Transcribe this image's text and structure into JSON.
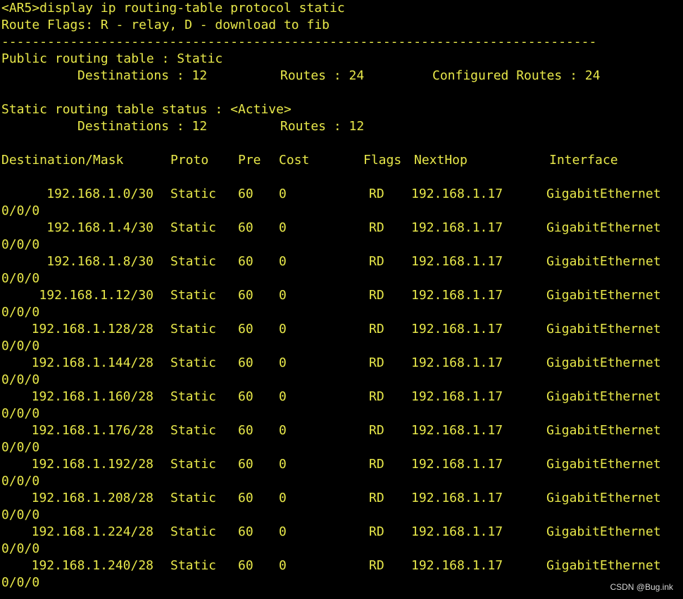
{
  "terminal": {
    "command_line": "<AR5>display ip routing-table protocol static",
    "route_flags": "Route Flags: R - relay, D - download to fib",
    "separator": "------------------------------------------------------------------------------",
    "public_table_title": "Public routing table : Static",
    "public_stats": {
      "destinations": "Destinations : 12",
      "routes": "Routes : 24",
      "configured": "Configured Routes : 24"
    },
    "status_title": "Static routing table status : <Active>",
    "status_stats": {
      "destinations": "Destinations : 12",
      "routes": "Routes : 12"
    },
    "headers": {
      "destination": "Destination/Mask",
      "proto": "Proto",
      "pre": "Pre",
      "cost": "Cost",
      "flags": "Flags",
      "nexthop": "NextHop",
      "interface": "Interface"
    },
    "routes": [
      {
        "dest": "192.168.1.0/30",
        "proto": "Static",
        "pre": "60",
        "cost": "0",
        "flags": "RD",
        "nexthop": "192.168.1.17",
        "iface": "GigabitEthernet",
        "iface_cont": "0/0/0"
      },
      {
        "dest": "192.168.1.4/30",
        "proto": "Static",
        "pre": "60",
        "cost": "0",
        "flags": "RD",
        "nexthop": "192.168.1.17",
        "iface": "GigabitEthernet",
        "iface_cont": "0/0/0"
      },
      {
        "dest": "192.168.1.8/30",
        "proto": "Static",
        "pre": "60",
        "cost": "0",
        "flags": "RD",
        "nexthop": "192.168.1.17",
        "iface": "GigabitEthernet",
        "iface_cont": "0/0/0"
      },
      {
        "dest": "192.168.1.12/30",
        "proto": "Static",
        "pre": "60",
        "cost": "0",
        "flags": "RD",
        "nexthop": "192.168.1.17",
        "iface": "GigabitEthernet",
        "iface_cont": "0/0/0"
      },
      {
        "dest": "192.168.1.128/28",
        "proto": "Static",
        "pre": "60",
        "cost": "0",
        "flags": "RD",
        "nexthop": "192.168.1.17",
        "iface": "GigabitEthernet",
        "iface_cont": "0/0/0"
      },
      {
        "dest": "192.168.1.144/28",
        "proto": "Static",
        "pre": "60",
        "cost": "0",
        "flags": "RD",
        "nexthop": "192.168.1.17",
        "iface": "GigabitEthernet",
        "iface_cont": "0/0/0"
      },
      {
        "dest": "192.168.1.160/28",
        "proto": "Static",
        "pre": "60",
        "cost": "0",
        "flags": "RD",
        "nexthop": "192.168.1.17",
        "iface": "GigabitEthernet",
        "iface_cont": "0/0/0"
      },
      {
        "dest": "192.168.1.176/28",
        "proto": "Static",
        "pre": "60",
        "cost": "0",
        "flags": "RD",
        "nexthop": "192.168.1.17",
        "iface": "GigabitEthernet",
        "iface_cont": "0/0/0"
      },
      {
        "dest": "192.168.1.192/28",
        "proto": "Static",
        "pre": "60",
        "cost": "0",
        "flags": "RD",
        "nexthop": "192.168.1.17",
        "iface": "GigabitEthernet",
        "iface_cont": "0/0/0"
      },
      {
        "dest": "192.168.1.208/28",
        "proto": "Static",
        "pre": "60",
        "cost": "0",
        "flags": "RD",
        "nexthop": "192.168.1.17",
        "iface": "GigabitEthernet",
        "iface_cont": "0/0/0"
      },
      {
        "dest": "192.168.1.224/28",
        "proto": "Static",
        "pre": "60",
        "cost": "0",
        "flags": "RD",
        "nexthop": "192.168.1.17",
        "iface": "GigabitEthernet",
        "iface_cont": "0/0/0"
      },
      {
        "dest": "192.168.1.240/28",
        "proto": "Static",
        "pre": "60",
        "cost": "0",
        "flags": "RD",
        "nexthop": "192.168.1.17",
        "iface": "GigabitEthernet",
        "iface_cont": "0/0/0"
      }
    ]
  },
  "watermark": "CSDN @Bug.ink",
  "colors": {
    "background": "#000000",
    "text": "#e8e84a"
  }
}
